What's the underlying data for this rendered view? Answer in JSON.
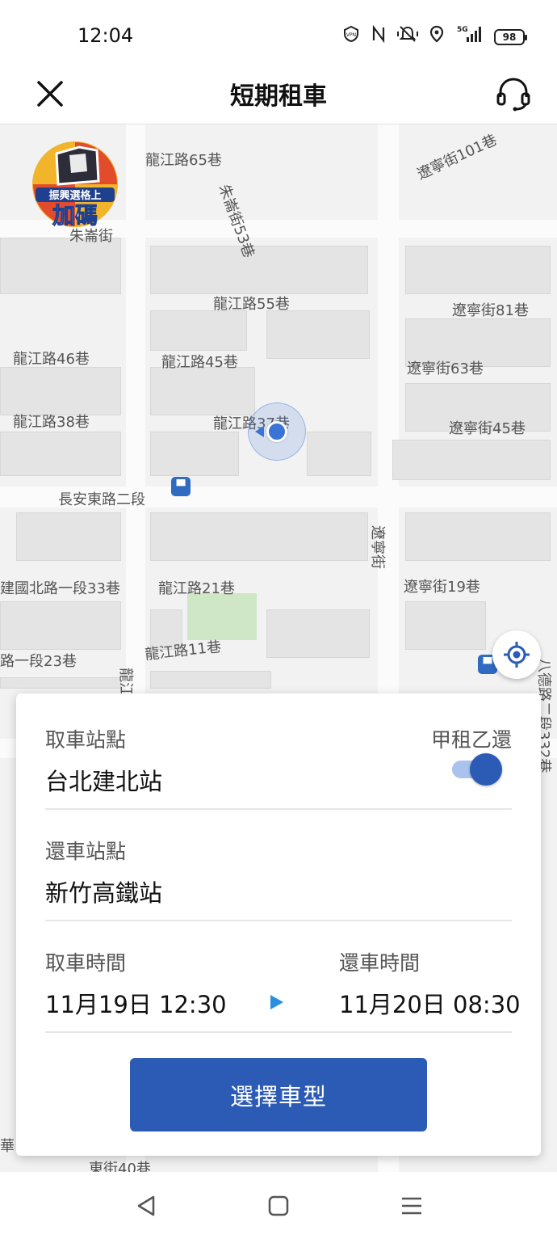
{
  "status_bar": {
    "time": "12:04",
    "icons": [
      "vpn-icon",
      "nfc-icon",
      "mute-icon",
      "location-icon",
      "signal-5g-icon"
    ],
    "battery": "98"
  },
  "app_bar": {
    "title": "短期租車",
    "left_icon": "close-icon",
    "right_icon": "headset-icon"
  },
  "map": {
    "promo_badge": {
      "line1": "振興選格上",
      "line2": "加碼"
    },
    "streets": [
      "龍江路65巷",
      "朱崙街53巷",
      "遼寧街101巷",
      "朱崙街",
      "龍江路55巷",
      "遼寧街81巷",
      "龍江路46巷",
      "龍江路45巷",
      "遼寧街63巷",
      "龍江路38巷",
      "龍江路37巷",
      "遼寧街45巷",
      "長安東路二段",
      "遼寧街",
      "建國北路一段33巷",
      "龍江路21巷",
      "遼寧街19巷",
      "路一段23巷",
      "龍江路11巷",
      "龍江",
      "八德路二段332巷",
      "華",
      "東街40巷"
    ]
  },
  "booking": {
    "pickup_label": "取車站點",
    "pickup_value": "台北建北站",
    "different_return_label": "甲租乙還",
    "different_return_on": true,
    "return_label": "還車站點",
    "return_value": "新竹高鐵站",
    "pickup_time_label": "取車時間",
    "pickup_time_value": "11月19日 12:30",
    "return_time_label": "還車時間",
    "return_time_value": "11月20日 08:30",
    "select_button": "選擇車型"
  },
  "colors": {
    "primary": "#2c5bb5",
    "toggle_track": "#a9c3ee",
    "arrow": "#2a8fe0",
    "map_bg": "#f2f2f2",
    "park": "#cfe6c7"
  }
}
